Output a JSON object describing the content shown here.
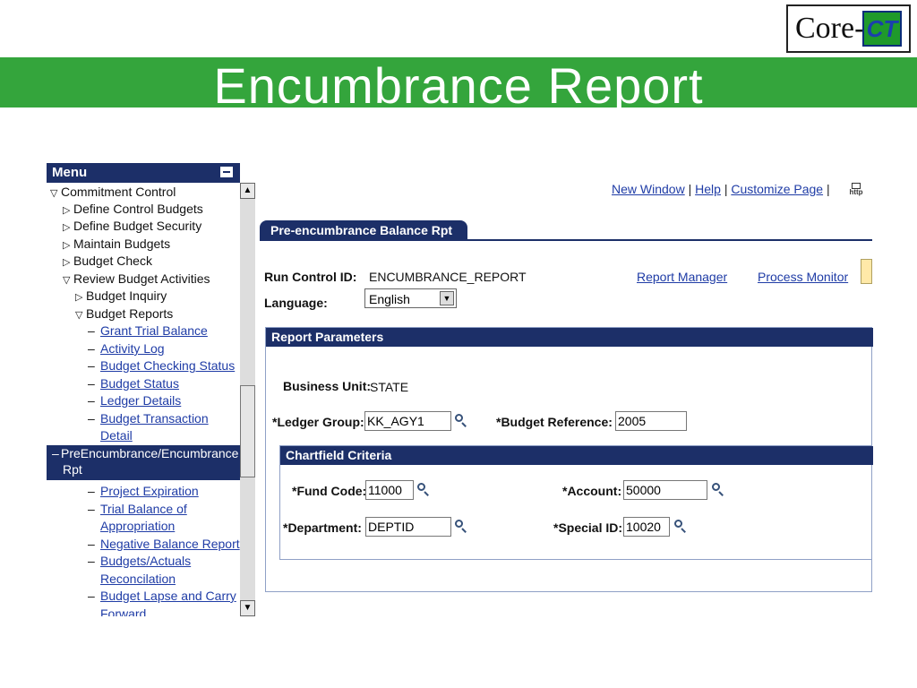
{
  "logo": {
    "text": "Core-",
    "badge": "CT"
  },
  "banner": {
    "title": "Encumbrance Report"
  },
  "menu": {
    "title": "Menu",
    "items": [
      {
        "label": "Commitment Control",
        "type": "folder-open"
      },
      {
        "label": "Define Control Budgets",
        "type": "folder"
      },
      {
        "label": "Define Budget Security",
        "type": "folder"
      },
      {
        "label": "Maintain Budgets",
        "type": "folder"
      },
      {
        "label": "Budget Check",
        "type": "folder"
      },
      {
        "label": "Review Budget Activities",
        "type": "folder-open"
      },
      {
        "label": "Budget Inquiry",
        "type": "folder"
      },
      {
        "label": "Budget Reports",
        "type": "folder-open"
      },
      {
        "label": "Grant Trial Balance",
        "type": "link"
      },
      {
        "label": "Activity Log",
        "type": "link"
      },
      {
        "label": "Budget Checking Status",
        "type": "link"
      },
      {
        "label": "Budget Status",
        "type": "link"
      },
      {
        "label": "Ledger Details",
        "type": "link"
      },
      {
        "label": "Budget Transaction",
        "type": "link"
      },
      {
        "label": "Detail",
        "type": "link-cont"
      },
      {
        "label": "PreEncumbrance/Encumbrance",
        "type": "selected"
      },
      {
        "label": "Rpt",
        "type": "selected-cont"
      },
      {
        "label": "Project Expiration",
        "type": "link"
      },
      {
        "label": "Trial Balance of",
        "type": "link"
      },
      {
        "label": "Appropriation",
        "type": "link-cont"
      },
      {
        "label": "Negative Balance Report",
        "type": "link"
      },
      {
        "label": "Budgets/Actuals",
        "type": "link"
      },
      {
        "label": "Reconcilation",
        "type": "link-cont"
      },
      {
        "label": "Budget Lapse and Carry",
        "type": "link"
      },
      {
        "label": "Forward",
        "type": "link-cont"
      }
    ]
  },
  "toplinks": {
    "new_window": "New Window",
    "help": "Help",
    "customize": "Customize Page",
    "sep": "|",
    "http_label": "http"
  },
  "tab": {
    "label": "Pre-encumbrance Balance Rpt"
  },
  "run": {
    "run_control_label": "Run Control ID:",
    "run_control_value": "ENCUMBRANCE_REPORT",
    "report_manager": "Report Manager",
    "process_monitor": "Process Monitor",
    "language_label": "Language:",
    "language_value": "English"
  },
  "params": {
    "title": "Report Parameters",
    "business_unit_label": "Business Unit:",
    "business_unit_value": "STATE",
    "ledger_group_label": "*Ledger Group:",
    "ledger_group_value": "KK_AGY1",
    "budget_ref_label": "*Budget Reference:",
    "budget_ref_value": "2005"
  },
  "chartfield": {
    "title": "Chartfield Criteria",
    "fund_label": "*Fund Code:",
    "fund_value": "11000",
    "account_label": "*Account:",
    "account_value": "50000",
    "dept_label": "*Department:",
    "dept_value": "DEPTID",
    "special_label": "*Special ID:",
    "special_value": "10020"
  },
  "colors": {
    "banner": "#34a53c",
    "navy": "#1c2f68",
    "link": "#1f3ca6"
  }
}
